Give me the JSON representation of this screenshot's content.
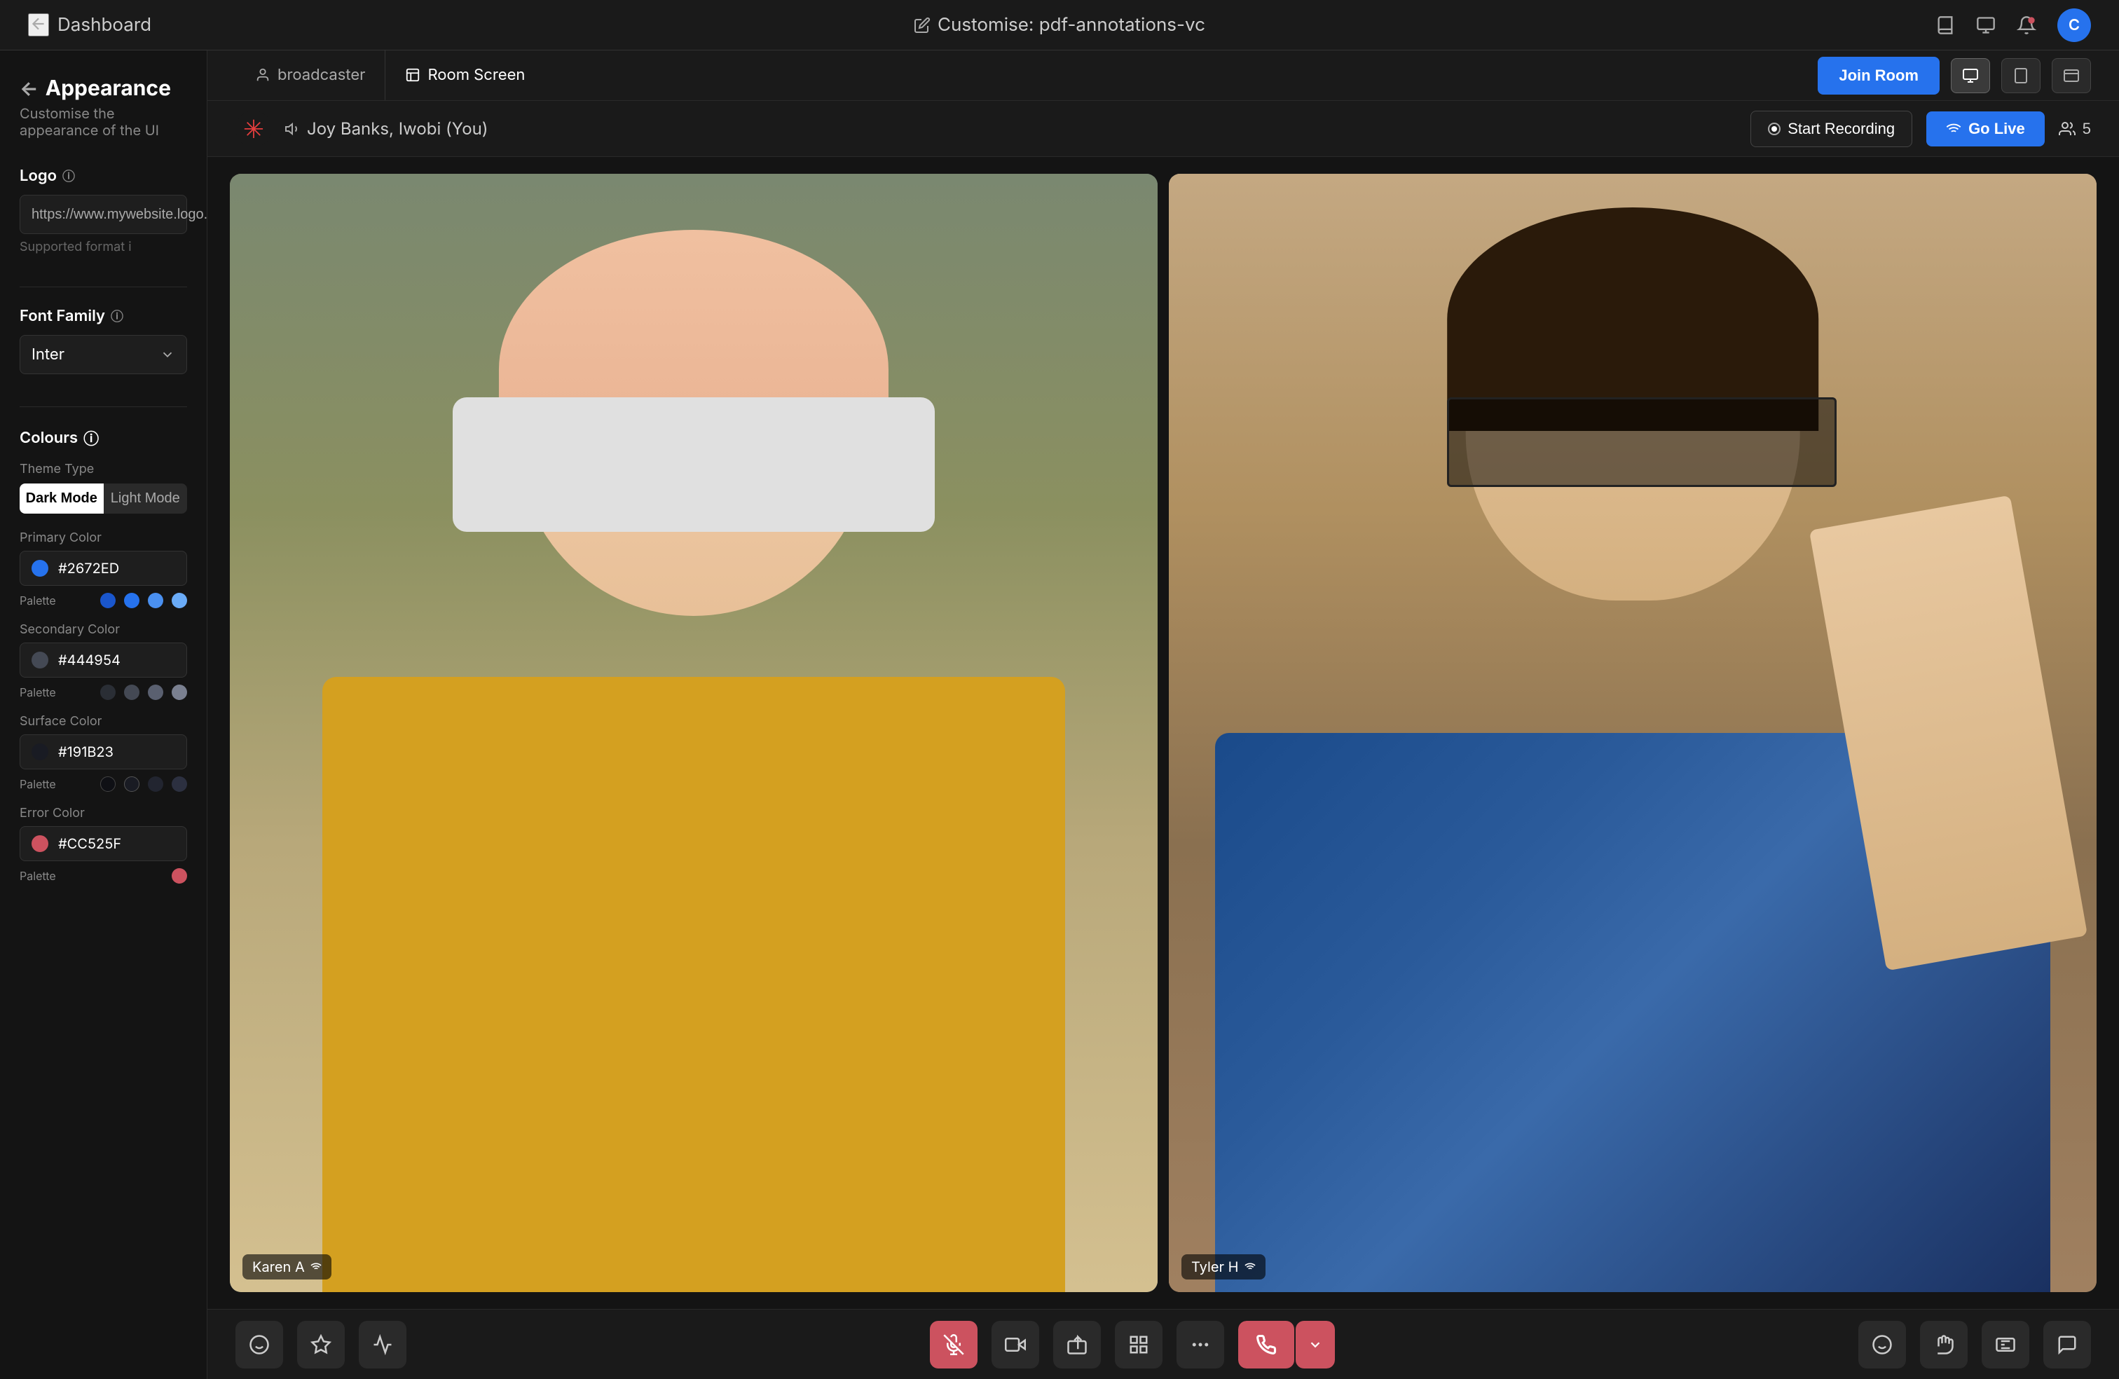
{
  "topbar": {
    "back_label": "Dashboard",
    "customize_label": "Customise: pdf-annotations-vc",
    "avatar_text": "C"
  },
  "sidebar": {
    "back_label": "Appearance",
    "subtitle": "Customise the appearance of the UI",
    "logo_section": {
      "label": "Logo",
      "input_value": "https://www.mywebsite.logo....",
      "supported_text": "Supported format i"
    },
    "font_section": {
      "label": "Font Family",
      "selected_font": "Inter"
    },
    "colours_section": {
      "label": "Colours",
      "theme_type_label": "Theme Type",
      "dark_mode_label": "Dark Mode",
      "light_mode_label": "Light Mode",
      "primary_color_label": "Primary Color",
      "primary_color_value": "#2672ED",
      "primary_color_hex": "#2672ED",
      "primary_palette": [
        "#1a56cc",
        "#2672ED",
        "#4a90f0",
        "#6aabf7"
      ],
      "secondary_color_label": "Secondary Color",
      "secondary_color_value": "#444954",
      "secondary_color_hex": "#444954",
      "secondary_palette": [
        "#2a2e35",
        "#444954",
        "#5a6070",
        "#7a8090"
      ],
      "surface_color_label": "Surface Color",
      "surface_color_value": "#191B23",
      "surface_color_hex": "#191B23",
      "surface_palette": [
        "#0f1015",
        "#191B23",
        "#222530",
        "#2c3040"
      ],
      "error_color_label": "Error Color",
      "error_color_value": "#CC525F",
      "error_color_hex": "#CC525F"
    }
  },
  "content_header": {
    "tab_broadcaster": "broadcaster",
    "tab_room_screen": "Room Screen",
    "join_room_label": "Join Room",
    "view_icons": [
      "monitor",
      "tablet",
      "desktop"
    ]
  },
  "room_topbar": {
    "laser_icon": "✳",
    "user_name": "Joy Banks, Iwobi (You)",
    "record_label": "Start Recording",
    "go_live_label": "Go Live",
    "participants_count": "5"
  },
  "video_grid": {
    "participant_1": {
      "name": "Karen A",
      "has_wifi": true
    },
    "participant_2": {
      "name": "Tyler H",
      "has_wifi": true
    }
  },
  "bottom_controls": {
    "left": [
      "emoji-reactions",
      "sparkle-effects",
      "audio-wave"
    ],
    "center": [
      "mic-muted",
      "video",
      "screen-share",
      "layout",
      "more"
    ],
    "right": [
      "emoji",
      "hand",
      "captions",
      "chat"
    ]
  }
}
